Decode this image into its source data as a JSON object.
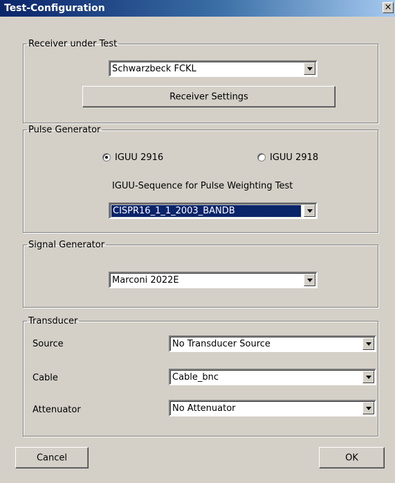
{
  "window": {
    "title": "Test-Configuration",
    "close_glyph": "×"
  },
  "receiver": {
    "legend": "Receiver under Test",
    "selected": "Schwarzbeck FCKL",
    "settings_button": "Receiver Settings"
  },
  "pulse": {
    "legend": "Pulse Generator",
    "options": [
      {
        "label": "IGUU 2916",
        "checked": true
      },
      {
        "label": "IGUU 2918",
        "checked": false
      }
    ],
    "sequence_label": "IGUU-Sequence for Pulse Weighting Test",
    "sequence_selected": "CISPR16_1_1_2003_BANDB"
  },
  "signal": {
    "legend": "Signal Generator",
    "selected": "Marconi 2022E"
  },
  "transducer": {
    "legend": "Transducer",
    "source_label": "Source",
    "source_value": "No Transducer Source",
    "cable_label": "Cable",
    "cable_value": "Cable_bnc",
    "attenuator_label": "Attenuator",
    "attenuator_value": "No Attenuator"
  },
  "buttons": {
    "cancel": "Cancel",
    "ok": "OK"
  },
  "icons": {
    "close": "close-icon",
    "dropdown": "chevron-down-icon"
  }
}
